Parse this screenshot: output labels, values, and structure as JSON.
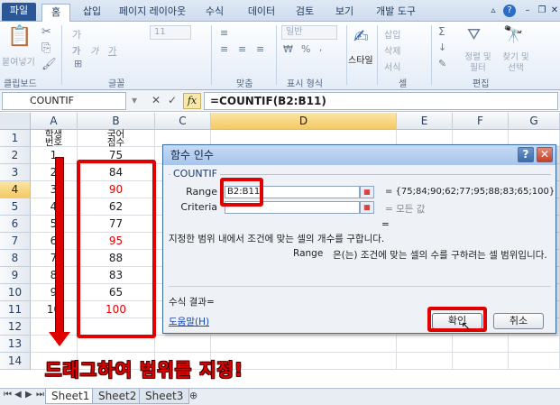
{
  "ribbon": {
    "tabs": [
      "파일",
      "홈",
      "삽입",
      "페이지 레이아웃",
      "수식",
      "데이터",
      "검토",
      "보기",
      "개발 도구"
    ],
    "groups": [
      "클립보드",
      "글꼴",
      "맞춤",
      "표시 형식",
      "스타일",
      "셀",
      "편집"
    ],
    "paste_label": "붙여넣기",
    "font_size": "11",
    "number_format": "일반",
    "style_label": "스타일",
    "cell_items": [
      "삽입",
      "삭제",
      "서식"
    ],
    "edit_items": [
      "정렬 및 필터",
      "찾기 및 선택"
    ]
  },
  "formula_bar": {
    "name_box": "COUNTIF",
    "fx_label": "fx",
    "formula": "=COUNTIF(B2:B11)"
  },
  "grid": {
    "columns": [
      "A",
      "B",
      "C",
      "D",
      "E",
      "F",
      "G"
    ],
    "selected_column": "D",
    "selected_row": "4",
    "row_numbers": [
      "1",
      "2",
      "3",
      "4",
      "5",
      "6",
      "7",
      "8",
      "9",
      "10",
      "11",
      "12",
      "13",
      "14"
    ],
    "header_a": [
      "학생",
      "번호"
    ],
    "header_b": [
      "국어",
      "점수"
    ],
    "students": [
      "1",
      "2",
      "3",
      "4",
      "5",
      "6",
      "7",
      "8",
      "9",
      "10"
    ],
    "scores": [
      "75",
      "84",
      "90",
      "62",
      "77",
      "95",
      "88",
      "83",
      "65",
      "100"
    ],
    "red_score_rows": [
      2,
      5,
      9
    ],
    "red_color": "#e00000"
  },
  "dialog": {
    "title": "함수 인수",
    "function_name": "COUNTIF",
    "arg1_label": "Range",
    "arg1_value": "B2:B11",
    "arg1_result": "= {75;84;90;62;77;95;88;83;65;100}",
    "arg2_label": "Criteria",
    "arg2_result": "= 모든 값",
    "equals": "=",
    "description": "지정한 범위 내에서 조건에 맞는 셀의 개수를 구합니다.",
    "arg_help_name": "Range",
    "arg_help_text": "은(는) 조건에 맞는 셀의 수를 구하려는 셀 범위입니다.",
    "result_label": "수식 결과=",
    "help_link": "도움말(H)",
    "ok_label": "확인",
    "cancel_label": "취소"
  },
  "annotation": {
    "caption": "드래그하여 범위를 지정!",
    "color": "#e00000"
  },
  "sheets": [
    "Sheet1",
    "Sheet2",
    "Sheet3"
  ]
}
